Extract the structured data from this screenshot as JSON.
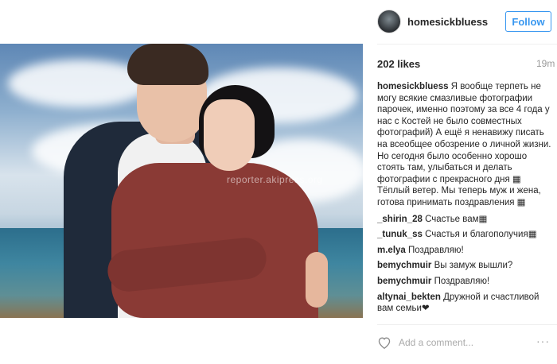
{
  "post": {
    "username": "homesickbluess",
    "follow_label": "Follow",
    "likes": "202 likes",
    "time": "19m",
    "watermark": "reporter.akipress.org",
    "caption_user": "homesickbluess",
    "caption_text": "Я вообще терпеть не могу всякие смазливые фотографии парочек, именно поэтому за все 4 года у нас с Костей не было совместных фотографий) А ещё я ненавижу писать на всеобщее обозрение о личной жизни. Но сегодня было особенно хорошо стоять там, улыбаться и делать фотографии с прекрасного дня ▦ Тёплый ветер. Мы теперь муж и жена, готова принимать поздравления ▦"
  },
  "comments": [
    {
      "user": "_shirin_28",
      "text": "Счастье вам▦"
    },
    {
      "user": "_tunuk_ss",
      "text": "Счастья и благополучия▦"
    },
    {
      "user": "m.elya",
      "text": "Поздравляю!"
    },
    {
      "user": "bemychmuir",
      "text": "Вы замуж вышли?"
    },
    {
      "user": "bemychmuir",
      "text": "Поздравляю!"
    },
    {
      "user": "altynai_bekten",
      "text": "Дружной и счастливой вам семьи❤"
    },
    {
      "user": "",
      "text": "▦▦ ▦"
    }
  ],
  "footer": {
    "add_comment_placeholder": "Add a comment...",
    "more_label": "···"
  },
  "icons": {
    "heart": "heart-icon",
    "more": "more-options-icon"
  },
  "colors": {
    "follow_blue": "#3897f0",
    "text": "#262626",
    "muted": "#999999"
  }
}
